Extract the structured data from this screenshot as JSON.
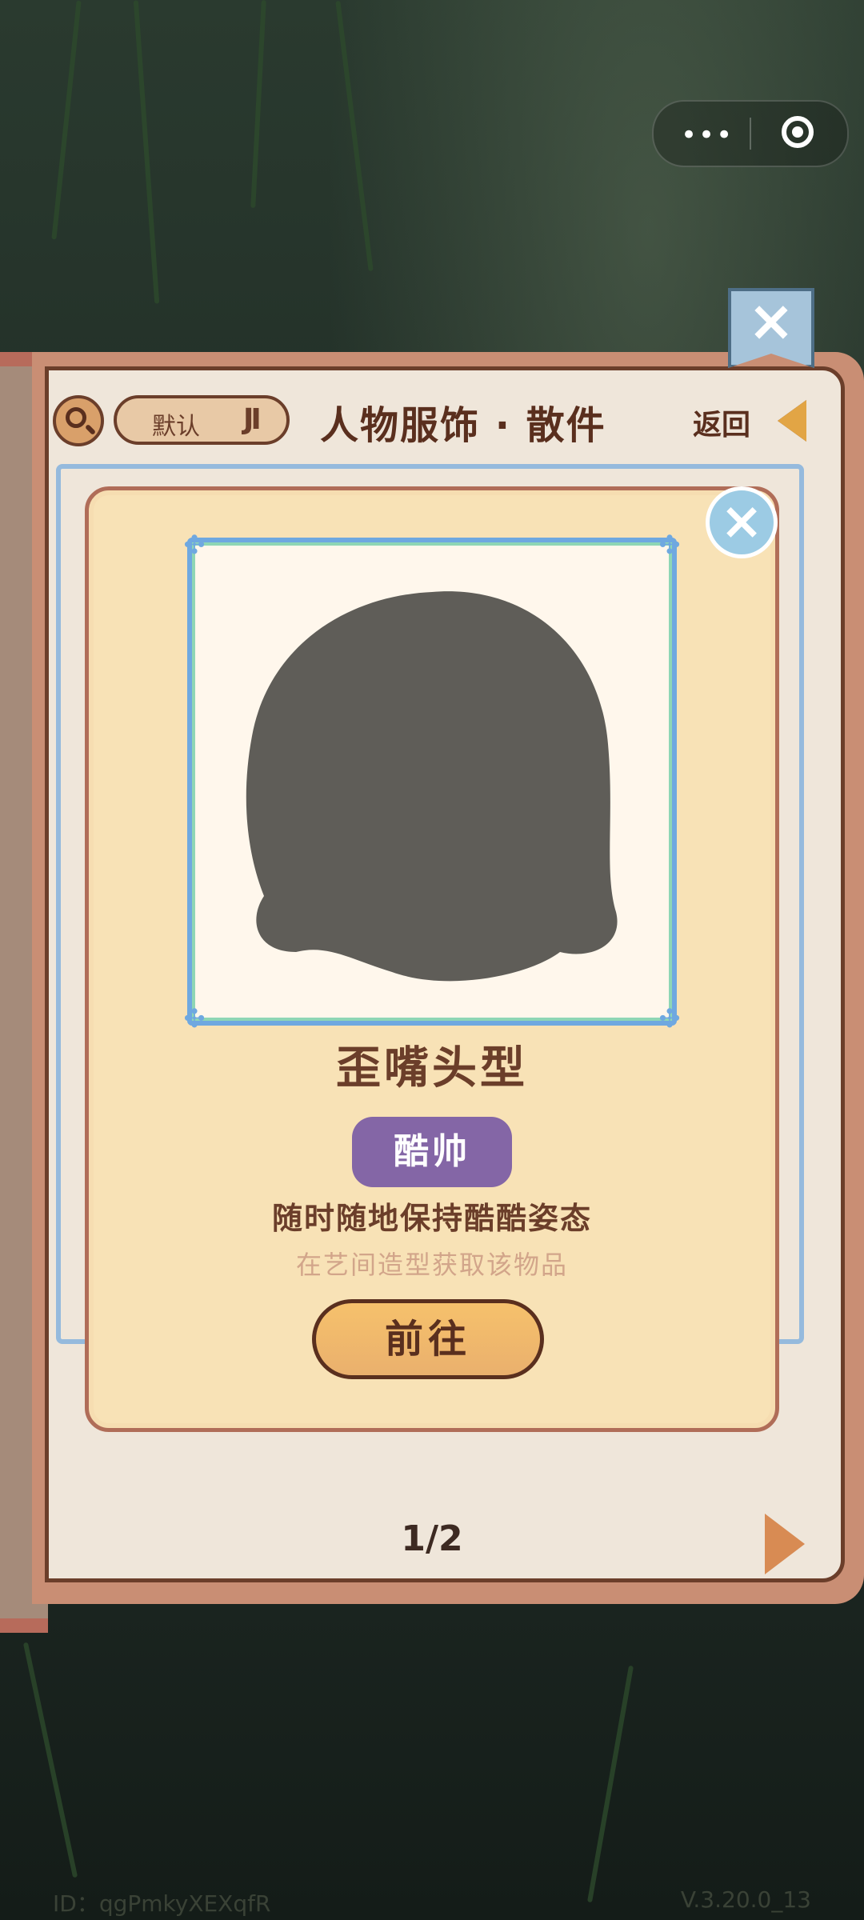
{
  "header": {
    "sort_label": "默认",
    "sort_icon": "JI",
    "title": "人物服饰 · 散件",
    "back_label": "返回"
  },
  "item": {
    "name": "歪嘴头型",
    "tag": "酷帅",
    "description": "随时随地保持酷酷姿态",
    "source": "在艺间造型获取该物品",
    "go_label": "前往"
  },
  "pager": {
    "text": "1/2"
  },
  "footer": {
    "id_text": "ID：qgPmkyXEXqfR",
    "version": "V.3.20.0_13"
  },
  "icons": {
    "close": "×",
    "search": "search-icon",
    "more": "•••",
    "target": "target-icon"
  },
  "colors": {
    "modal_bg": "#f8e2b6",
    "tag_bg": "#8466a6",
    "button_bg": "#eab06d"
  }
}
